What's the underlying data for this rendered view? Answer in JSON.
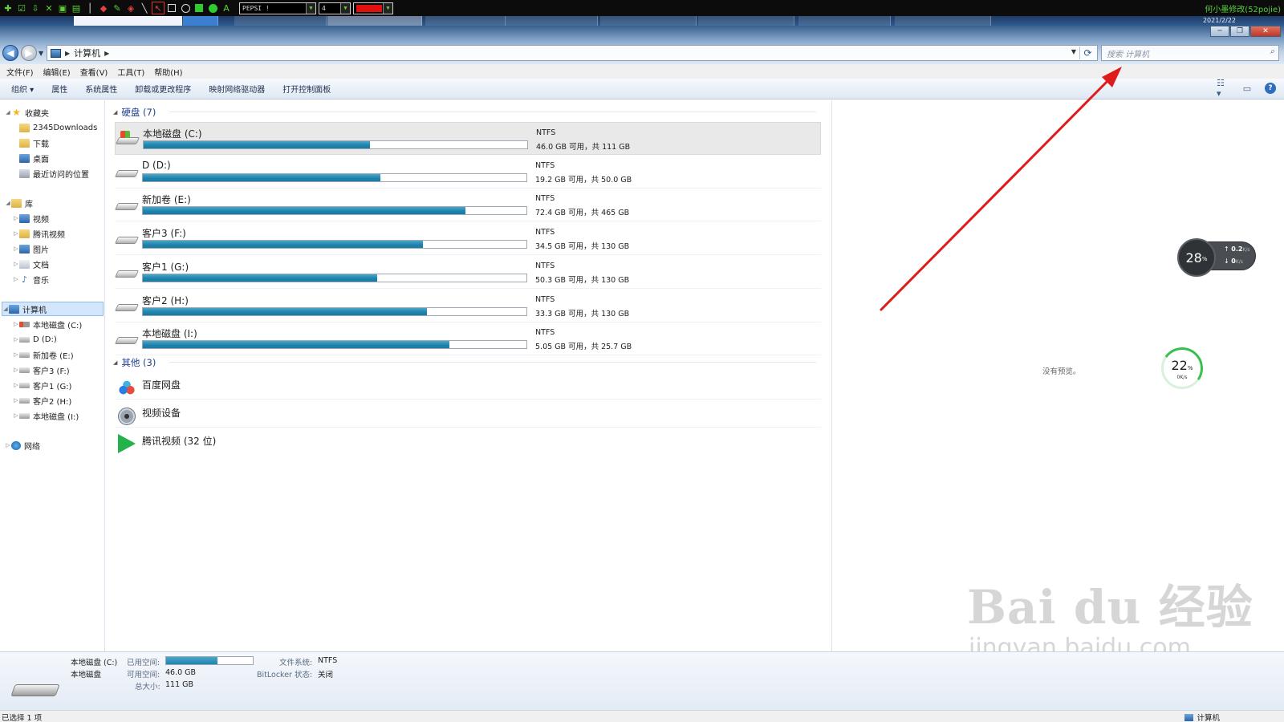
{
  "annotation_toolbar": {
    "font_combo": "PEPSI !",
    "size_combo": "4",
    "current_color": "#e01010",
    "title": "何小墨修改(52pojie)"
  },
  "taskstrip": {
    "date": "2021/2/22"
  },
  "window": {
    "breadcrumb": "计算机",
    "search_placeholder": "搜索 计算机",
    "minimize_glyph": "─",
    "restore_glyph": "❐",
    "close_glyph": "✕"
  },
  "menu": [
    "文件(F)",
    "编辑(E)",
    "查看(V)",
    "工具(T)",
    "帮助(H)"
  ],
  "commands": {
    "organize": "组织 ▾",
    "items": [
      "属性",
      "系统属性",
      "卸载或更改程序",
      "映射网络驱动器",
      "打开控制面板"
    ]
  },
  "nav": {
    "favorites": {
      "label": "收藏夹",
      "items": [
        "2345Downloads",
        "下载",
        "桌面",
        "最近访问的位置"
      ]
    },
    "libraries": {
      "label": "库",
      "items": [
        "视频",
        "腾讯视频",
        "图片",
        "文档",
        "音乐"
      ]
    },
    "computer": {
      "label": "计算机",
      "items": [
        "本地磁盘 (C:)",
        "D (D:)",
        "新加卷 (E:)",
        "客户3 (F:)",
        "客户1 (G:)",
        "客户2 (H:)",
        "本地磁盘 (I:)"
      ]
    },
    "network": {
      "label": "网络"
    }
  },
  "groups": {
    "hard_disks": "硬盘 (7)",
    "other": "其他 (3)"
  },
  "drives": [
    {
      "name": "本地磁盘 (C:)",
      "fs": "NTFS",
      "free": "46.0 GB 可用，共 111 GB",
      "used_fraction": 0.59
    },
    {
      "name": "D (D:)",
      "fs": "NTFS",
      "free": "19.2 GB 可用，共 50.0 GB",
      "used_fraction": 0.62
    },
    {
      "name": "新加卷 (E:)",
      "fs": "NTFS",
      "free": "72.4 GB 可用，共 465 GB",
      "used_fraction": 0.84
    },
    {
      "name": "客户3 (F:)",
      "fs": "NTFS",
      "free": "34.5 GB 可用，共 130 GB",
      "used_fraction": 0.73
    },
    {
      "name": "客户1 (G:)",
      "fs": "NTFS",
      "free": "50.3 GB 可用，共 130 GB",
      "used_fraction": 0.61
    },
    {
      "name": "客户2 (H:)",
      "fs": "NTFS",
      "free": "33.3 GB 可用，共 130 GB",
      "used_fraction": 0.74
    },
    {
      "name": "本地磁盘 (I:)",
      "fs": "NTFS",
      "free": "5.05 GB 可用，共 25.7 GB",
      "used_fraction": 0.8
    }
  ],
  "others": [
    {
      "name": "百度网盘",
      "icon": "baidu-netdisk-icon"
    },
    {
      "name": "视频设备",
      "icon": "webcam-icon"
    },
    {
      "name": "腾讯视频 (32 位)",
      "icon": "tencent-video-icon"
    }
  ],
  "preview": {
    "no_preview": "没有预览。",
    "net_widget": {
      "percent": "28",
      "up": "0.2",
      "down": "0",
      "unit": "K/s"
    },
    "mem_widget": {
      "percent": "22",
      "speed": "0K/s"
    },
    "watermark": "Bai du 经验",
    "watermark_sub": "jingyan.baidu.com"
  },
  "details": {
    "name": "本地磁盘 (C:)",
    "type": "本地磁盘",
    "used_label": "已用空间:",
    "free_label": "可用空间:",
    "free_value": "46.0 GB",
    "total_label": "总大小:",
    "total_value": "111 GB",
    "fs_label": "文件系统:",
    "fs_value": "NTFS",
    "bitlocker_label": "BitLocker 状态:",
    "bitlocker_value": "关闭",
    "used_fraction": 0.59
  },
  "status": {
    "left": "已选择 1 项",
    "right": "计算机"
  },
  "colors": {
    "arrow": "#e01b1b",
    "bar_fill": "#1f84ad"
  }
}
